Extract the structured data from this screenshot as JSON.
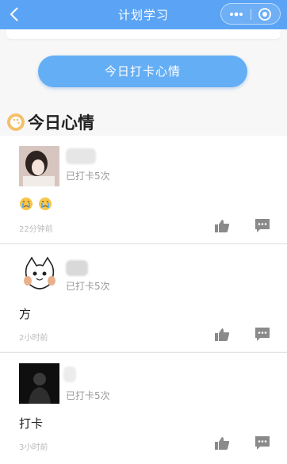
{
  "nav": {
    "title": "计划学习"
  },
  "main_button": {
    "label": "今日打卡心情"
  },
  "section": {
    "title": "今日心情"
  },
  "posts": [
    {
      "count": "已打卡5次",
      "content": "",
      "emojis": [
        "crying-face",
        "crying-face"
      ],
      "time": "22分钟前"
    },
    {
      "count": "已打卡5次",
      "content": "方",
      "time": "2小时前"
    },
    {
      "count": "已打卡5次",
      "content": "打卡",
      "time": "3小时前"
    }
  ],
  "colors": {
    "nav": "#5ba4f5",
    "button": "#64aef5",
    "icon_gray": "#888888"
  }
}
